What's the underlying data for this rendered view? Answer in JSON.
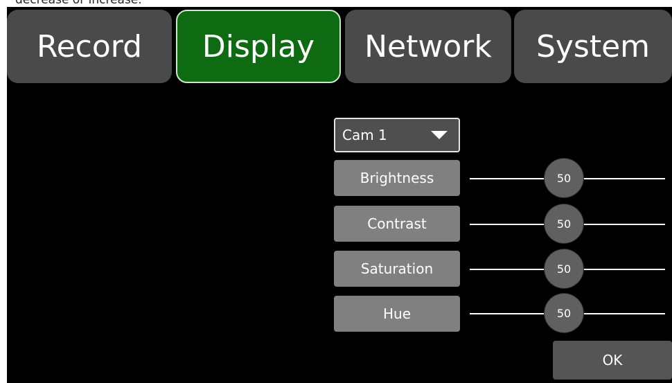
{
  "caption": "decrease or increase.",
  "tabs": [
    {
      "label": "Record"
    },
    {
      "label": "Display"
    },
    {
      "label": "Network"
    },
    {
      "label": "System"
    }
  ],
  "active_tab": "Display",
  "camera_select": {
    "value": "Cam 1"
  },
  "settings": [
    {
      "label": "Brightness",
      "value": "50"
    },
    {
      "label": "Contrast",
      "value": "50"
    },
    {
      "label": "Saturation",
      "value": "50"
    },
    {
      "label": "Hue",
      "value": "50"
    }
  ],
  "ok_label": "OK",
  "colors": {
    "background": "#000000",
    "active_tab": "#0f6b12",
    "tab": "#4a4a4a",
    "button": "#808080"
  },
  "icons": {
    "dropdown_arrow": "triangle-down-icon"
  }
}
